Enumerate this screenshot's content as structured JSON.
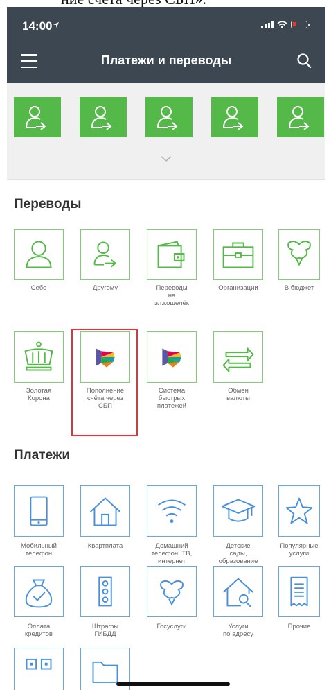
{
  "page_caption": "ние счета через СБП».",
  "status_bar": {
    "time": "14:00"
  },
  "header": {
    "title": "Платежи и переводы",
    "menu_icon": "hamburger-menu-icon",
    "search_icon": "search-icon"
  },
  "favorites": {
    "tiles": 5,
    "icon": "person-transfer-icon",
    "expand_icon": "chevron-down-icon"
  },
  "colors": {
    "header_bg": "#3d4752",
    "transfer_green": "#54b948",
    "payments_blue": "#4a90d9",
    "highlight_red": "#e8303a"
  },
  "transfers": {
    "title": "Переводы",
    "items": [
      {
        "label": "Себе",
        "icon": "person-icon"
      },
      {
        "label": "Другому",
        "icon": "person-arrow-icon"
      },
      {
        "label": "Переводы\nна\nэл.кошелёк",
        "icon": "wallet-icon"
      },
      {
        "label": "Организации",
        "icon": "briefcase-icon"
      },
      {
        "label": "В бюджет",
        "icon": "coat-of-arms-icon"
      },
      {
        "label": "Золотая\nКорона",
        "icon": "crown-icon"
      },
      {
        "label": "Пополнение\nсчёта через\nСБП",
        "icon": "sbp-logo-icon",
        "highlighted": true
      },
      {
        "label": "Система\nбыстрых\nплатежей",
        "icon": "sbp-logo-icon"
      },
      {
        "label": "Обмен\nвалюты",
        "icon": "exchange-arrows-icon"
      }
    ]
  },
  "payments": {
    "title": "Платежи",
    "items": [
      {
        "label": "Мобильный\nтелефон",
        "icon": "mobile-phone-icon"
      },
      {
        "label": "Квартплата",
        "icon": "house-icon"
      },
      {
        "label": "Домашний\nтелефон, ТВ,\nинтернет",
        "icon": "wifi-icon"
      },
      {
        "label": "Детские\nсады,\nобразование",
        "icon": "graduation-cap-icon"
      },
      {
        "label": "Популярные\nуслуги",
        "icon": "star-icon"
      },
      {
        "label": "Оплата\nкредитов",
        "icon": "money-bag-icon"
      },
      {
        "label": "Штрафы\nГИБДД",
        "icon": "traffic-light-icon"
      },
      {
        "label": "Госуслуги",
        "icon": "coat-of-arms-icon"
      },
      {
        "label": "Услуги\nпо адресу",
        "icon": "house-search-icon"
      },
      {
        "label": "Прочие",
        "icon": "document-icon"
      }
    ],
    "partial_icons": [
      "qr-code-icon",
      "folder-icon"
    ]
  }
}
